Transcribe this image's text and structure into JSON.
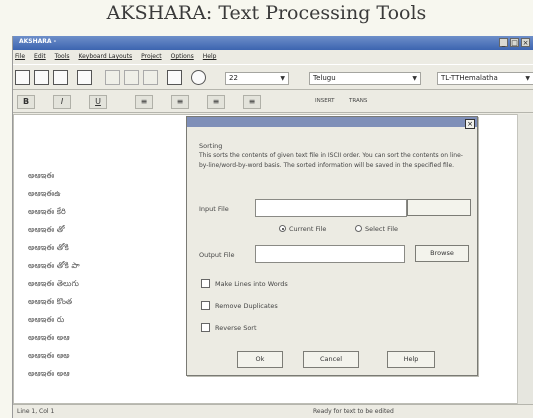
{
  "banner": {
    "title": "AKSHARA: Text Processing Tools"
  },
  "window": {
    "title": "AKSHARA - ",
    "controls": [
      "_",
      "□",
      "×"
    ]
  },
  "menu": [
    "File",
    "Edit",
    "Tools",
    "Keyboard Layouts",
    "Project",
    "Options",
    "Help"
  ],
  "toolbar": {
    "font_size": "22",
    "language": "Telugu",
    "font_name": "TL-TTHemalatha"
  },
  "format_bar": {
    "bold": "B",
    "italic": "I",
    "underline": "U",
    "labels": [
      "INSERT",
      "TRANS"
    ]
  },
  "editor": {
    "lines": [
      "అఆఇఈ",
      "అఆఇఈఉ",
      "అఆఇఈ కేరి",
      "అఆఇఈ తో",
      "అఆఇఈ తోకి",
      "అఆఇఈ తోకి పా",
      "అఆఇఈ తెలుగు",
      "అఆఇఈ కొంత",
      "అఆఇఈ రు",
      "అఆఇఈ అఆ",
      "అఆఇఈ ఆఅ",
      "అఆఇఈ అఆ"
    ]
  },
  "dialog": {
    "heading": "Sorting",
    "description": "This sorts the contents of given text file in ISCII order. You can sort the contents on line-by-line/word-by-word basis. The sorted information will be saved in the specified file.",
    "input_label": "Input File",
    "radio_current": "Current File",
    "radio_select": "Select File",
    "output_label": "Output File",
    "browse": "Browse",
    "checks": [
      "Make Lines into Words",
      "Remove Duplicates",
      "Reverse Sort"
    ],
    "ok": "Ok",
    "cancel": "Cancel",
    "help": "Help"
  },
  "status": {
    "left": "Line 1, Col 1",
    "center": "Ready for text to be edited"
  }
}
